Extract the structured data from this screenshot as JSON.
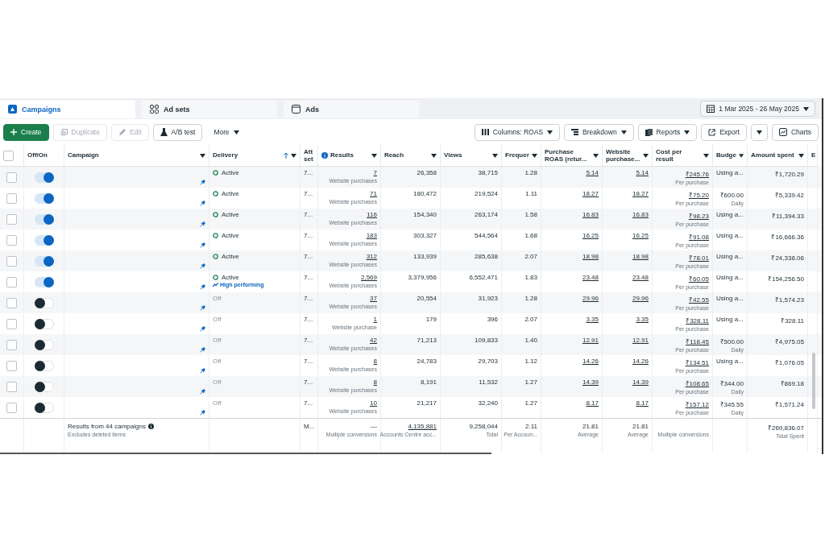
{
  "tabs": [
    {
      "label": "Campaigns",
      "selected": true
    },
    {
      "label": "Ad sets",
      "selected": false
    },
    {
      "label": "Ads",
      "selected": false
    }
  ],
  "date_range": "1 Mar 2025 - 26 May 2025",
  "toolbar_left": [
    {
      "label": "Create",
      "kind": "create",
      "disabled": false
    },
    {
      "label": "Duplicate",
      "kind": "duplicate",
      "disabled": true
    },
    {
      "label": "Edit",
      "kind": "edit",
      "disabled": true
    },
    {
      "label": "A/B test",
      "kind": "abtest",
      "disabled": false
    },
    {
      "label": "More",
      "kind": "more",
      "disabled": false
    }
  ],
  "toolbar_right": [
    {
      "label": "Columns: ROAS",
      "kind": "columns"
    },
    {
      "label": "Breakdown",
      "kind": "breakdown"
    },
    {
      "label": "Reports",
      "kind": "reports"
    },
    {
      "label": "Export",
      "kind": "export"
    },
    {
      "label": "Charts",
      "kind": "charts"
    }
  ],
  "select_all_checked": false,
  "columns": [
    "Off/On",
    "Campaign",
    "Delivery",
    "Att set",
    "Results",
    "Reach",
    "Views",
    "Frequer",
    "Purchase ROAS (retur...",
    "Website purchase...",
    "Cost per result",
    "Budge",
    "Amount spent",
    "E"
  ],
  "rows": [
    {
      "checked": false,
      "on": true,
      "delivery": "Active",
      "active": true,
      "att": "7...",
      "results": "7",
      "results_label": "Website purchases",
      "reach": "26,358",
      "views": "38,715",
      "frequency": "1.28",
      "roas": "5.14",
      "website": "5.14",
      "cost": "₹245.76",
      "cost_label": "Per purchase",
      "budget": "Using a...",
      "amount": "₹1,720.29"
    },
    {
      "checked": false,
      "on": true,
      "delivery": "Active",
      "active": true,
      "att": "7...",
      "results": "71",
      "results_label": "Website purchases",
      "reach": "180,472",
      "views": "219,524",
      "frequency": "1.11",
      "roas": "18.27",
      "website": "18.27",
      "cost": "₹75.20",
      "cost_label": "Per purchase",
      "budget": "₹600.00",
      "budget_label": "Daily",
      "amount": "₹5,339.42"
    },
    {
      "checked": false,
      "on": true,
      "delivery": "Active",
      "active": true,
      "att": "7...",
      "results": "116",
      "results_label": "Website purchases",
      "reach": "154,340",
      "views": "263,174",
      "frequency": "1.58",
      "roas": "16.83",
      "website": "16.83",
      "cost": "₹98.23",
      "cost_label": "Per purchase",
      "budget": "Using a...",
      "amount": "₹11,394.33"
    },
    {
      "checked": false,
      "on": true,
      "delivery": "Active",
      "active": true,
      "att": "7...",
      "results": "183",
      "results_label": "Website purchases",
      "reach": "303,327",
      "views": "544,564",
      "frequency": "1.68",
      "roas": "16.25",
      "website": "16.25",
      "cost": "₹91.08",
      "cost_label": "Per purchase",
      "budget": "Using a...",
      "amount": "₹16,666.36"
    },
    {
      "checked": false,
      "on": true,
      "delivery": "Active",
      "active": true,
      "att": "7...",
      "results": "312",
      "results_label": "Website purchases",
      "reach": "133,939",
      "views": "285,638",
      "frequency": "2.07",
      "roas": "18.98",
      "website": "18.98",
      "cost": "₹78.01",
      "cost_label": "Per purchase",
      "budget": "Using a...",
      "amount": "₹24,338.06"
    },
    {
      "checked": false,
      "on": true,
      "delivery": "Active",
      "active": true,
      "note": "High performing",
      "att": "7...",
      "results": "2,569",
      "results_label": "Website purchases",
      "reach": "3,379,956",
      "views": "6,552,471",
      "frequency": "1.83",
      "roas": "23.48",
      "website": "23.48",
      "cost": "₹60.05",
      "cost_label": "Per purchase",
      "budget": "Using a...",
      "amount": "₹154,256.50"
    },
    {
      "checked": false,
      "on": false,
      "delivery": "Off",
      "active": false,
      "att": "7...",
      "results": "37",
      "results_label": "Website purchases",
      "reach": "20,554",
      "views": "31,923",
      "frequency": "1.28",
      "roas": "29.96",
      "website": "29.96",
      "cost": "₹42.55",
      "cost_label": "Per purchase",
      "budget": "Using a...",
      "amount": "₹1,574.23"
    },
    {
      "checked": false,
      "on": false,
      "delivery": "Off",
      "active": false,
      "att": "7...",
      "results": "1",
      "results_label": "Website purchase",
      "reach": "179",
      "views": "396",
      "frequency": "2.07",
      "roas": "3.35",
      "website": "3.35",
      "cost": "₹328.11",
      "cost_label": "Per purchase",
      "budget": "Using a...",
      "amount": "₹328.11"
    },
    {
      "checked": false,
      "on": false,
      "delivery": "Off",
      "active": false,
      "att": "7...",
      "results": "42",
      "results_label": "Website purchases",
      "reach": "71,213",
      "views": "109,833",
      "frequency": "1.40",
      "roas": "12.91",
      "website": "12.91",
      "cost": "₹118.45",
      "cost_label": "Per purchase",
      "budget": "₹500.00",
      "budget_label": "Daily",
      "amount": "₹4,975.05"
    },
    {
      "checked": false,
      "on": false,
      "delivery": "Off",
      "active": false,
      "att": "7...",
      "results": "8",
      "results_label": "Website purchases",
      "reach": "24,783",
      "views": "29,703",
      "frequency": "1.12",
      "roas": "14.26",
      "website": "14.26",
      "cost": "₹134.51",
      "cost_label": "Per purchase",
      "budget": "Using a...",
      "amount": "₹1,076.05"
    },
    {
      "checked": false,
      "on": false,
      "delivery": "Off",
      "active": false,
      "att": "7...",
      "results": "8",
      "results_label": "Website purchases",
      "reach": "8,191",
      "views": "11,532",
      "frequency": "1.27",
      "roas": "14.39",
      "website": "14.39",
      "cost": "₹108.65",
      "cost_label": "Per purchase",
      "budget": "₹344.00",
      "budget_label": "Daily",
      "amount": "₹869.18"
    },
    {
      "checked": false,
      "on": false,
      "delivery": "Off",
      "active": false,
      "att": "7...",
      "results": "10",
      "results_label": "Website purchases",
      "reach": "21,217",
      "views": "32,240",
      "frequency": "1.27",
      "roas": "8.17",
      "website": "8.17",
      "cost": "₹157.12",
      "cost_label": "Per purchase",
      "budget": "₹345.55",
      "budget_label": "Daily",
      "amount": "₹1,571.24"
    }
  ],
  "summary": {
    "title": "Results from 44 campaigns",
    "subtitle": "Excludes deleted items",
    "att": "M...",
    "results": "—",
    "results_label": "Multiple conversions",
    "reach": "4,135,881",
    "reach_label": "Accounts Centre acc...",
    "views": "9,258,044",
    "views_label": "Total",
    "frequency": "2.11",
    "frequency_label": "Per Accoun...",
    "roas": "21.81",
    "roas_label": "Average",
    "website": "21.81",
    "website_label": "Average",
    "cost_label": "Multiple conversions",
    "amount": "₹269,836.07",
    "amount_label": "Total Spent"
  }
}
